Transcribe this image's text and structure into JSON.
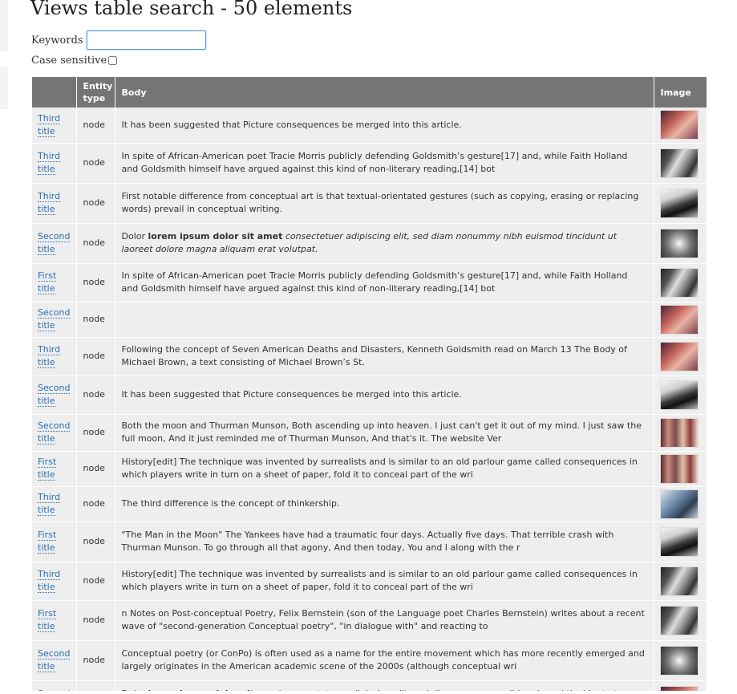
{
  "page": {
    "title": "Views table search - 50 elements"
  },
  "filters": {
    "keywords_label": "Keywords",
    "keywords_value": "",
    "case_label": "Case sensitive"
  },
  "table": {
    "headers": {
      "title": "",
      "entity_type": "Entity type",
      "body": "Body",
      "image": "Image"
    },
    "rows": [
      {
        "title": "Third title",
        "type": "node",
        "body": "It has been suggested that Picture consequences be merged into this article.",
        "image": "sunset-photo-icon",
        "h": 44
      },
      {
        "title": "Third title",
        "type": "node",
        "body": "In spite of African-American poet Tracie Morris publicly defending Goldsmith’s gesture[17] and, while Faith Holland and Goldsmith himself have argued against this kind of non-literary reading,[14] bot",
        "image": "bw-portrait-photo-icon",
        "h": 50
      },
      {
        "title": "Third title",
        "type": "node",
        "body": "First notable difference from conceptual art is that textual-orientated gestures (such as copying, erasing or replacing words) prevail in conceptual writing.",
        "image": "bw-bridge-photo-icon",
        "h": 50
      },
      {
        "title": "Second title",
        "type": "node",
        "body_parts": {
          "plain": "Dolor ",
          "bold": "lorem ipsum dolor sit amet",
          "italic": " consectetuer adipiscing elit, sed diam nonummy nibh euismod tincidunt ut laoreet dolore magna aliquam erat volutpat."
        },
        "image": "tunnel-photo-icon",
        "h": 50
      },
      {
        "title": "First title",
        "type": "node",
        "body": "In spite of African-American poet Tracie Morris publicly defending Goldsmith’s gesture[17] and, while Faith Holland and Goldsmith himself have argued against this kind of non-literary reading,[14] bot",
        "image": "bw-portrait-photo-icon",
        "h": 48
      },
      {
        "title": "Second title",
        "type": "node",
        "body": "",
        "image": "sunset-photo-icon",
        "h": 44
      },
      {
        "title": "Third title",
        "type": "node",
        "body": "Following the concept of Seven American Deaths and Disasters, Kenneth Goldsmith read on March 13 The Body of Michael Brown, a text consisting of Michael Brown’s St.",
        "image": "sunset-photo-icon",
        "h": 48
      },
      {
        "title": "Second title",
        "type": "node",
        "body": "It has been suggested that Picture consequences be merged into this article.",
        "image": "bw-bridge-photo-icon",
        "h": 48
      },
      {
        "title": "Second title",
        "type": "node",
        "body": "Both the moon and Thurman Munson, Both ascending up into heaven. I just can't get it out of my mind. I just saw the full moon, And it just reminded me of Thurman Munson, And that's it. The website Ver",
        "image": "crowd-photo-icon",
        "h": 46
      },
      {
        "title": "First title",
        "type": "node",
        "body": "History[edit] The technique was invented by surrealists and is similar to an old parlour game called consequences in which players write in turn on a sheet of paper, fold it to conceal part of the wri",
        "image": "crowd-photo-icon",
        "h": 44
      },
      {
        "title": "Third title",
        "type": "node",
        "body": "The third difference is the concept of thinkership.",
        "image": "blue-photo-icon",
        "h": 44
      },
      {
        "title": "First title",
        "type": "node",
        "body": "\"The Man in the Moon\" The Yankees have had a traumatic four days. Actually five days. That terrible crash with Thurman Munson. To go through all that agony, And then today, You and I along with the r",
        "image": "bw-bridge-photo-icon",
        "h": 50
      },
      {
        "title": "Third title",
        "type": "node",
        "body": "History[edit] The technique was invented by surrealists and is similar to an old parlour game called consequences in which players write in turn on a sheet of paper, fold it to conceal part of the wri",
        "image": "bw-portrait-photo-icon",
        "h": 48
      },
      {
        "title": "First title",
        "type": "node",
        "body": "n Notes on Post-conceptual Poetry, Felix Bernstein (son of the Language poet Charles Bernstein) writes about a recent wave of \"second-generation Conceptual poetry\", \"in dialogue with\" and reacting to",
        "image": "bw-portrait-photo-icon",
        "h": 50
      },
      {
        "title": "Second title",
        "type": "node",
        "body": "Conceptual poetry (or ConPo) is often used as a name for the entire movement which has more recently emerged and largely originates in the American academic scene of the 2000s (although conceptual wri",
        "image": "tunnel-photo-icon",
        "h": 50
      },
      {
        "title": "Second title",
        "type": "node",
        "body_parts": {
          "plain": "Dolor ",
          "bold": "lorem ipsum dolor sit amet",
          "italic": " consectetuer adipiscing elit, sed diam nonummy nibh euismod tincidunt ut laoreet dolore magna aliquam erat volutpat."
        },
        "image": "sunset-photo-icon",
        "h": 50
      }
    ]
  }
}
